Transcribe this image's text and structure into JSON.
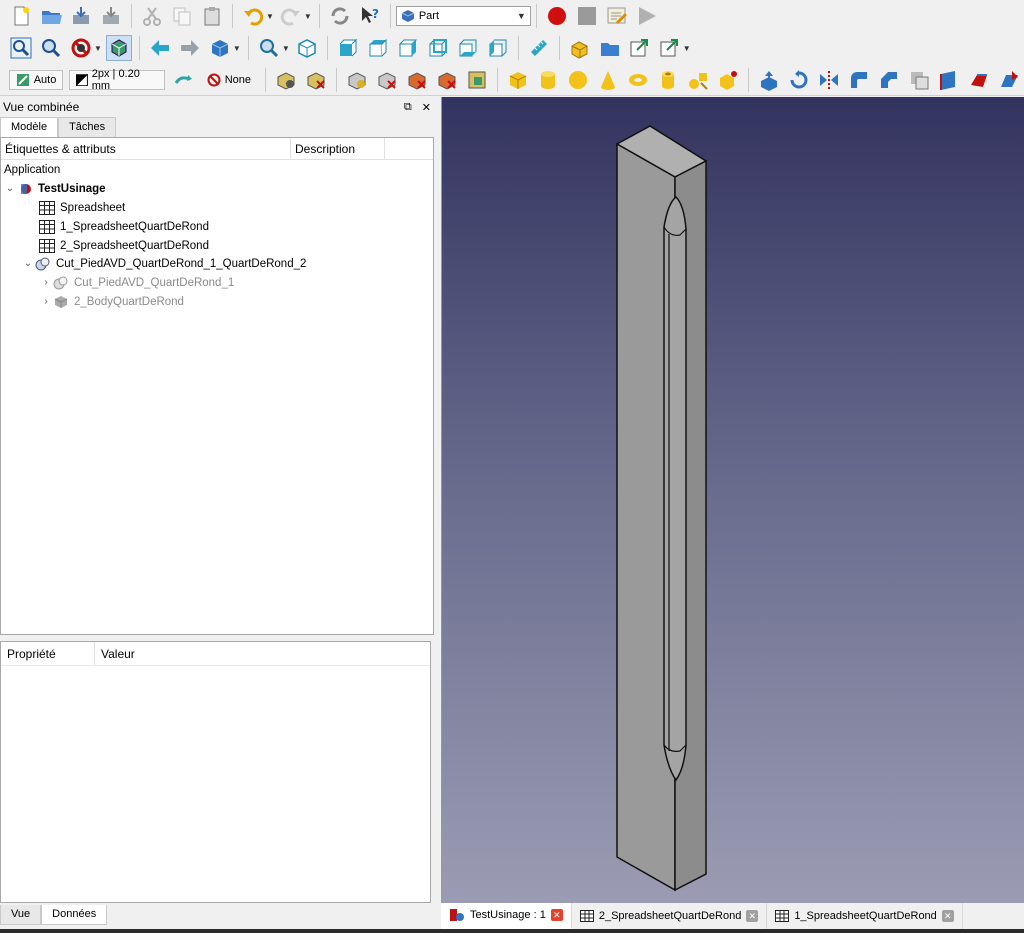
{
  "toolbar": {
    "workbench": "Part",
    "auto_label": "Auto",
    "line_label": "2px | 0.20 mm",
    "none_label": "None"
  },
  "panel": {
    "title": "Vue combinée",
    "tab_model": "Modèle",
    "tab_tasks": "Tâches",
    "col_labels": "Étiquettes & attributs",
    "col_description": "Description",
    "tab_view": "Vue",
    "tab_data": "Données"
  },
  "tree": {
    "application": "Application",
    "document": "TestUsinage",
    "items": [
      "Spreadsheet",
      "1_SpreadsheetQuartDeRond",
      "2_SpreadsheetQuartDeRond",
      "Cut_PiedAVD_QuartDeRond_1_QuartDeRond_2",
      "Cut_PiedAVD_QuartDeRond_1",
      "2_BodyQuartDeRond"
    ]
  },
  "properties": {
    "col_property": "Propriété",
    "col_value": "Valeur"
  },
  "doc_tabs": [
    "TestUsinage : 1",
    "2_SpreadsheetQuartDeRond",
    "1_SpreadsheetQuartDeRond"
  ],
  "colors": {
    "viewport_top": "#33335f",
    "viewport_bottom": "#9b9cb3",
    "shape_fill": "#9a9a9a",
    "record_red": "#d01010"
  }
}
